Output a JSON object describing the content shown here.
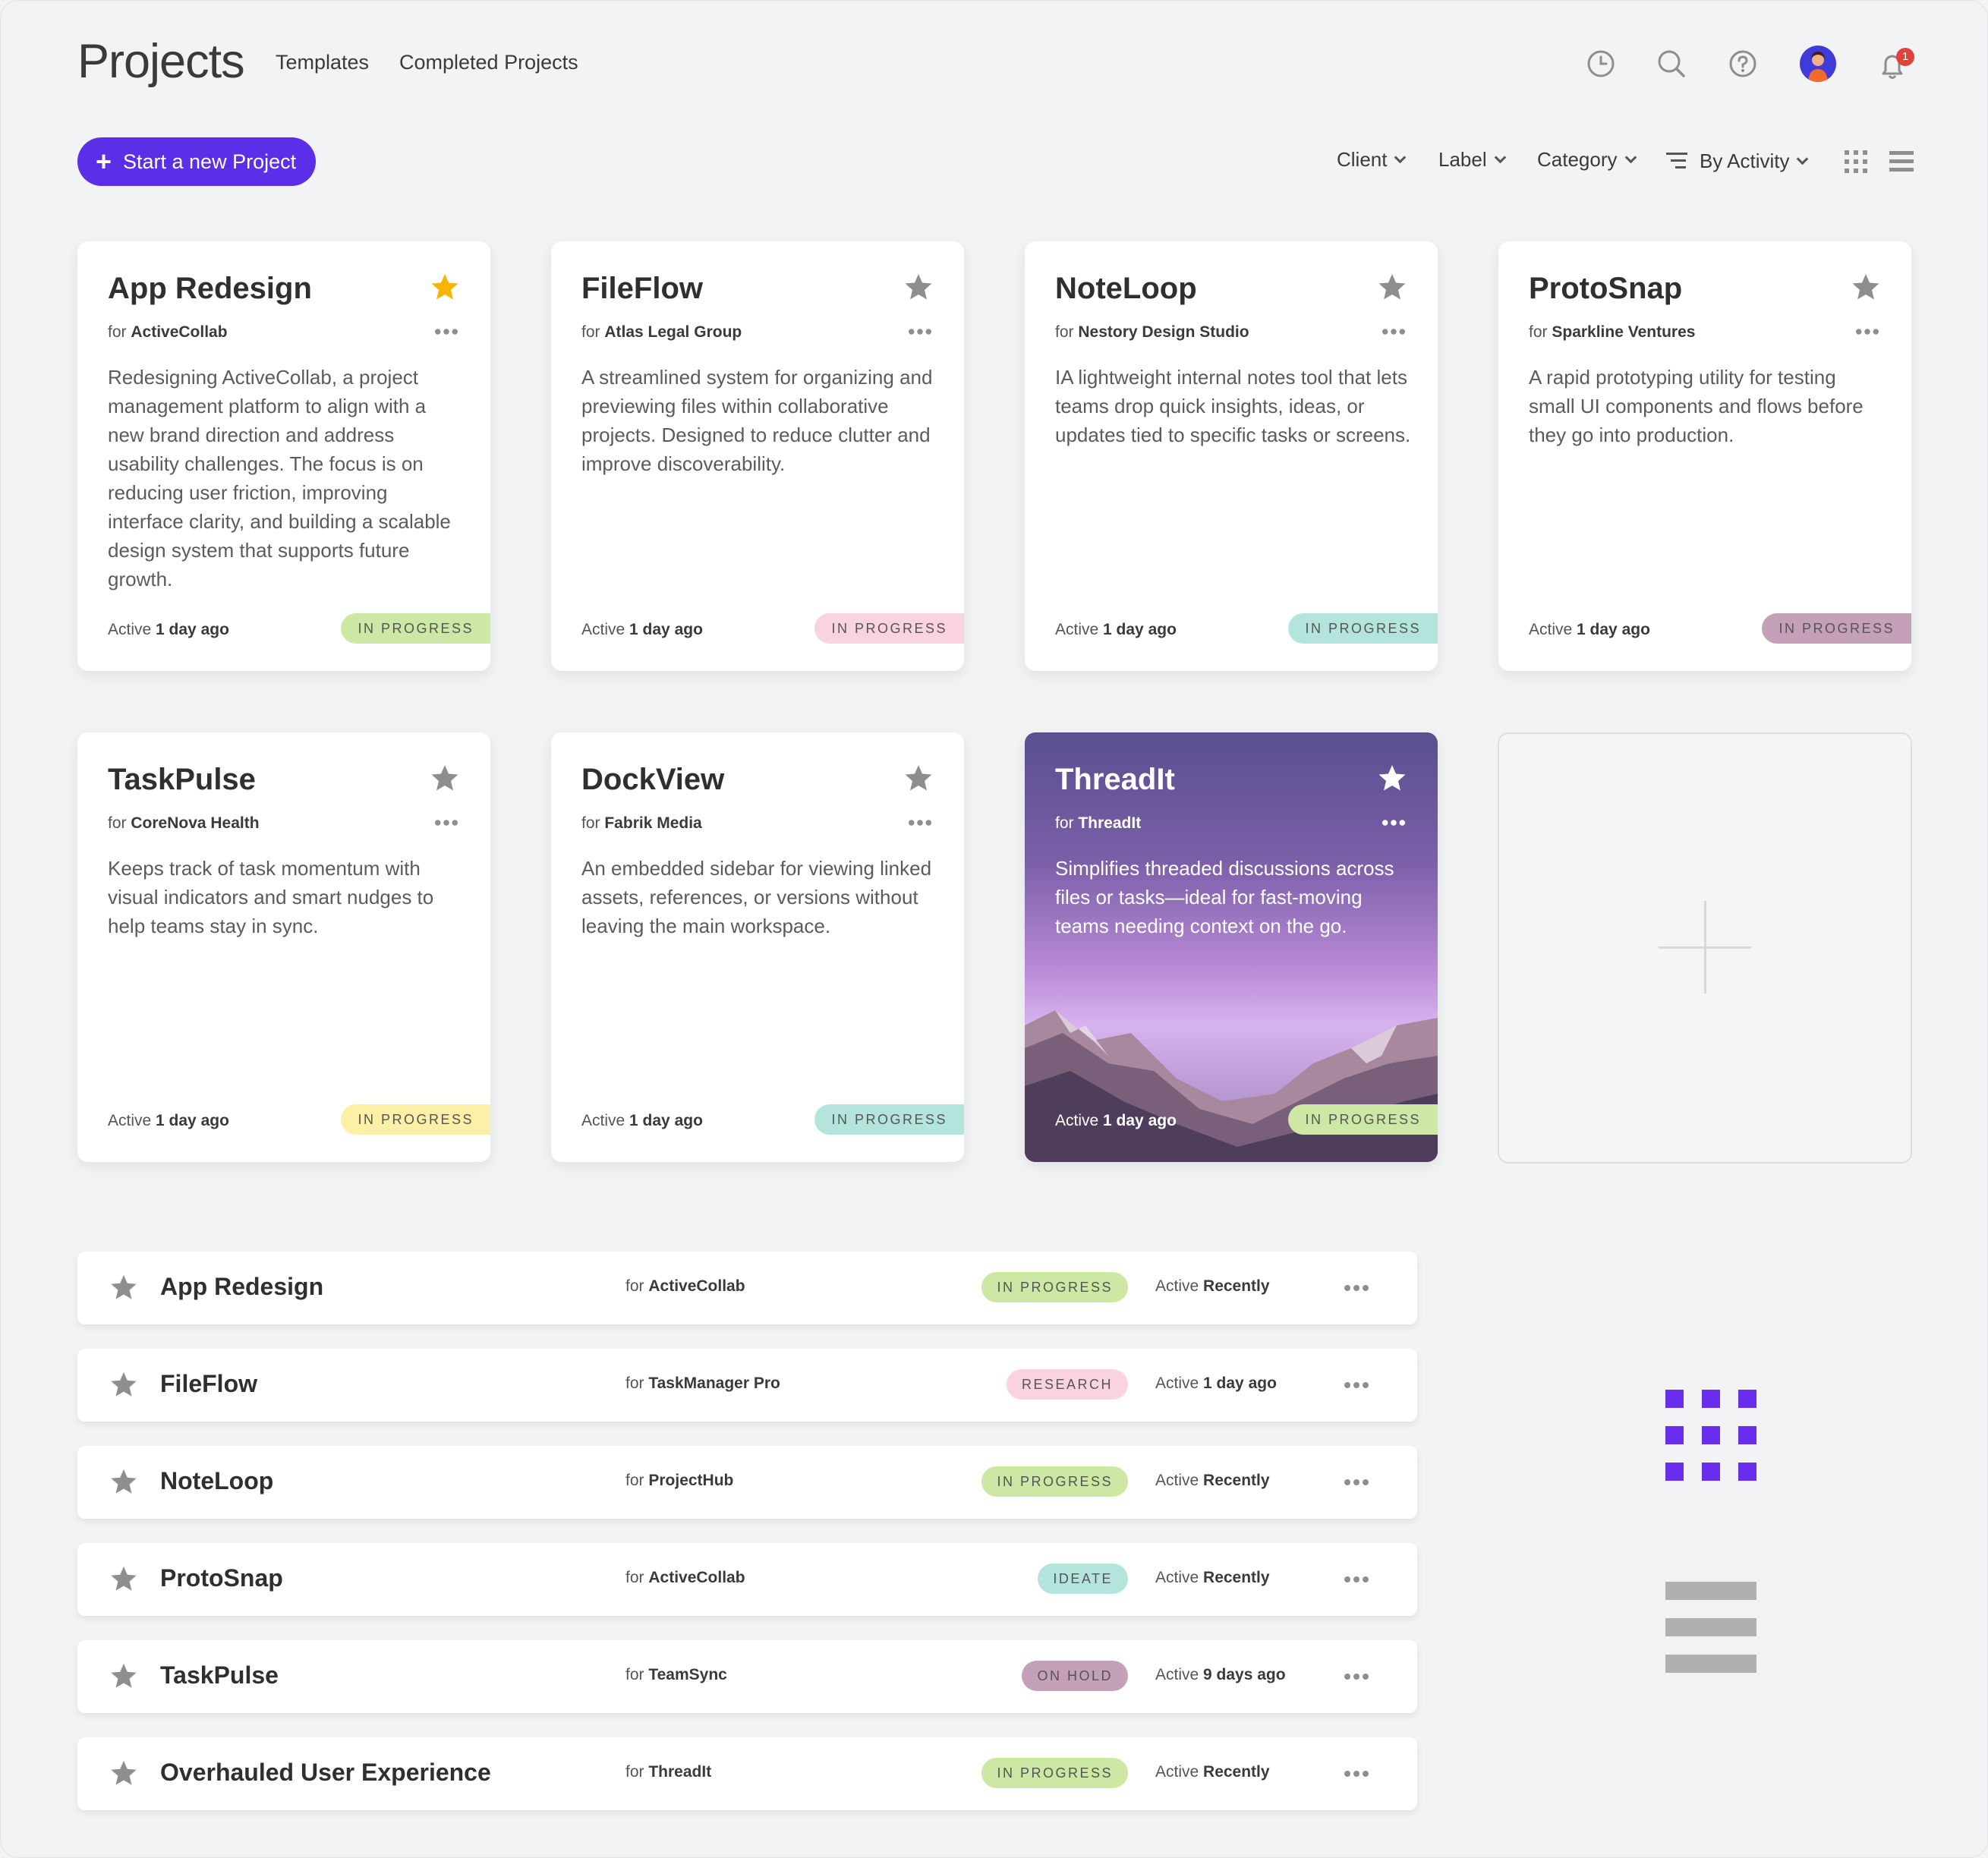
{
  "header": {
    "title": "Projects",
    "nav": [
      "Templates",
      "Completed Projects"
    ],
    "notification_count": "1",
    "new_project_label": "Start a new Project",
    "filters": [
      "Client",
      "Label",
      "Category"
    ],
    "sort_label": "By Activity",
    "icons": [
      "clock-icon",
      "search-icon",
      "help-icon",
      "avatar",
      "bell-icon"
    ]
  },
  "colors": {
    "accent": "#5b2ee8",
    "star_active": "#f7b500",
    "star_inactive": "#8e8e91",
    "badge_green": "#cde7a4",
    "badge_pink": "#f9d3e0",
    "badge_teal": "#b4e5dc",
    "badge_mauve": "#c4a0b9",
    "badge_yellow": "#fbf0a6"
  },
  "cards": [
    {
      "title": "App Redesign",
      "client_prefix": "for",
      "client": "ActiveCollab",
      "desc": "Redesigning ActiveCollab, a project management platform to align with a new brand direction and address usability challenges. The focus is on reducing user friction, improving interface clarity, and building a scalable design system that supports future growth.",
      "active_prefix": "Active",
      "active": "1 day ago",
      "badge": "IN PROGRESS",
      "badge_color": "green",
      "starred": true
    },
    {
      "title": "FileFlow",
      "client_prefix": "for",
      "client": "Atlas Legal Group",
      "desc": "A streamlined system for organizing and previewing files within collaborative projects. Designed to reduce clutter and improve discoverability.",
      "active_prefix": "Active",
      "active": "1 day ago",
      "badge": "IN PROGRESS",
      "badge_color": "pink",
      "starred": false
    },
    {
      "title": "NoteLoop",
      "client_prefix": "for",
      "client": "Nestory Design Studio",
      "desc": "IA lightweight internal notes tool that lets teams drop quick insights, ideas, or updates tied to specific tasks or screens.",
      "active_prefix": "Active",
      "active": "1 day ago",
      "badge": "IN PROGRESS",
      "badge_color": "teal",
      "starred": false
    },
    {
      "title": "ProtoSnap",
      "client_prefix": "for",
      "client": "Sparkline Ventures",
      "desc": "A rapid prototyping utility for testing small UI components and flows before they go into production.",
      "active_prefix": "Active",
      "active": "1 day ago",
      "badge": "IN PROGRESS",
      "badge_color": "mauve",
      "starred": false
    },
    {
      "title": "TaskPulse",
      "client_prefix": "for",
      "client": "CoreNova Health",
      "desc": "Keeps track of task momentum with visual indicators and smart nudges to help teams stay in sync.",
      "active_prefix": "Active",
      "active": "1 day ago",
      "badge": "IN PROGRESS",
      "badge_color": "yellow",
      "starred": false
    },
    {
      "title": "DockView",
      "client_prefix": "for",
      "client": "Fabrik Media",
      "desc": "An embedded sidebar for viewing linked assets, references, or versions without leaving the main workspace.",
      "active_prefix": "Active",
      "active": "1 day ago",
      "badge": "IN PROGRESS",
      "badge_color": "teal",
      "starred": false
    },
    {
      "title": "ThreadIt",
      "client_prefix": "for",
      "client": "ThreadIt",
      "desc": "Simplifies threaded discussions across files or tasks—ideal for fast-moving teams needing context on the go.",
      "active_prefix": "Active",
      "active": "1 day ago",
      "badge": "IN PROGRESS",
      "badge_color": "green",
      "starred": false
    }
  ],
  "rows": [
    {
      "title": "App Redesign",
      "client_prefix": "for",
      "client": "ActiveCollab",
      "badge": "IN PROGRESS",
      "badge_color": "green",
      "active_prefix": "Active",
      "active": "Recently"
    },
    {
      "title": "FileFlow",
      "client_prefix": "for",
      "client": "TaskManager Pro",
      "badge": "RESEARCH",
      "badge_color": "pink",
      "active_prefix": "Active",
      "active": "1 day ago"
    },
    {
      "title": "NoteLoop",
      "client_prefix": "for",
      "client": "ProjectHub",
      "badge": "IN PROGRESS",
      "badge_color": "green",
      "active_prefix": "Active",
      "active": "Recently"
    },
    {
      "title": "ProtoSnap",
      "client_prefix": "for",
      "client": "ActiveCollab",
      "badge": "IDEATE",
      "badge_color": "teal",
      "active_prefix": "Active",
      "active": "Recently"
    },
    {
      "title": "TaskPulse",
      "client_prefix": "for",
      "client": "TeamSync",
      "badge": "ON HOLD",
      "badge_color": "mauve",
      "active_prefix": "Active",
      "active": "9 days ago"
    },
    {
      "title": "Overhauled User Experience",
      "client_prefix": "for",
      "client": "ThreadIt",
      "badge": "IN PROGRESS",
      "badge_color": "green",
      "active_prefix": "Active",
      "active": "Recently"
    }
  ]
}
